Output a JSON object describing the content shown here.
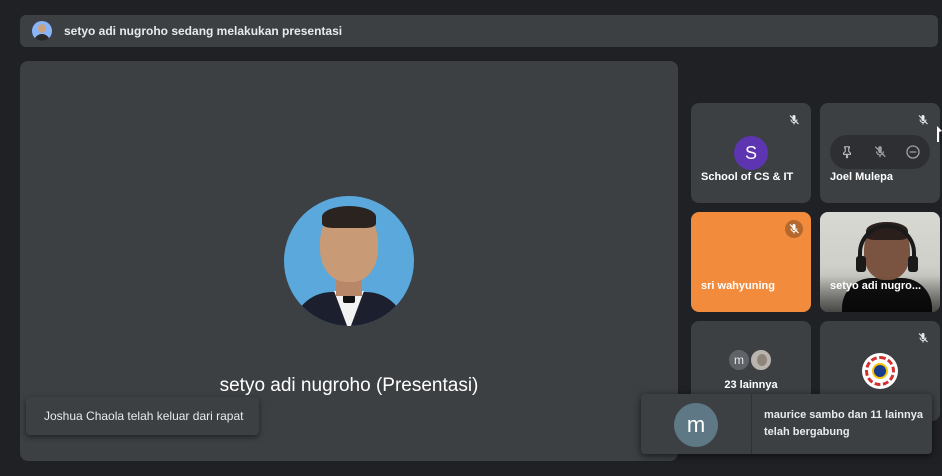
{
  "banner": {
    "text": "setyo adi nugroho sedang melakukan presentasi",
    "avatar_icon": "user-photo-avatar"
  },
  "stage": {
    "presenter_name": "setyo adi nugroho (Presentasi)"
  },
  "toasts": {
    "left": "Joshua Chaola telah keluar dari rapat",
    "right_initial": "m",
    "right": "maurice sambo dan 11 lainnya telah bergabung"
  },
  "tiles": [
    {
      "label": "School of CS & IT",
      "initial": "S",
      "muted": true,
      "avatar_color": "#5e35b1"
    },
    {
      "label": "Joel Mulepa",
      "muted": true,
      "controls": [
        "pin-icon",
        "mic-off-icon",
        "remove-icon"
      ]
    },
    {
      "label": "sri wahyuning",
      "muted": true,
      "bg_color": "#f28b3c"
    },
    {
      "label": "setyo adi nugro...",
      "muted": false,
      "video": true
    },
    {
      "label": "23 lainnya",
      "initial": "m"
    },
    {
      "label": "",
      "muted": true,
      "logo_icon": "organization-logo-icon"
    }
  ],
  "colors": {
    "background": "#202124",
    "surface": "#3c4043",
    "accent_orange": "#f28b3c",
    "accent_purple": "#5e35b1"
  }
}
